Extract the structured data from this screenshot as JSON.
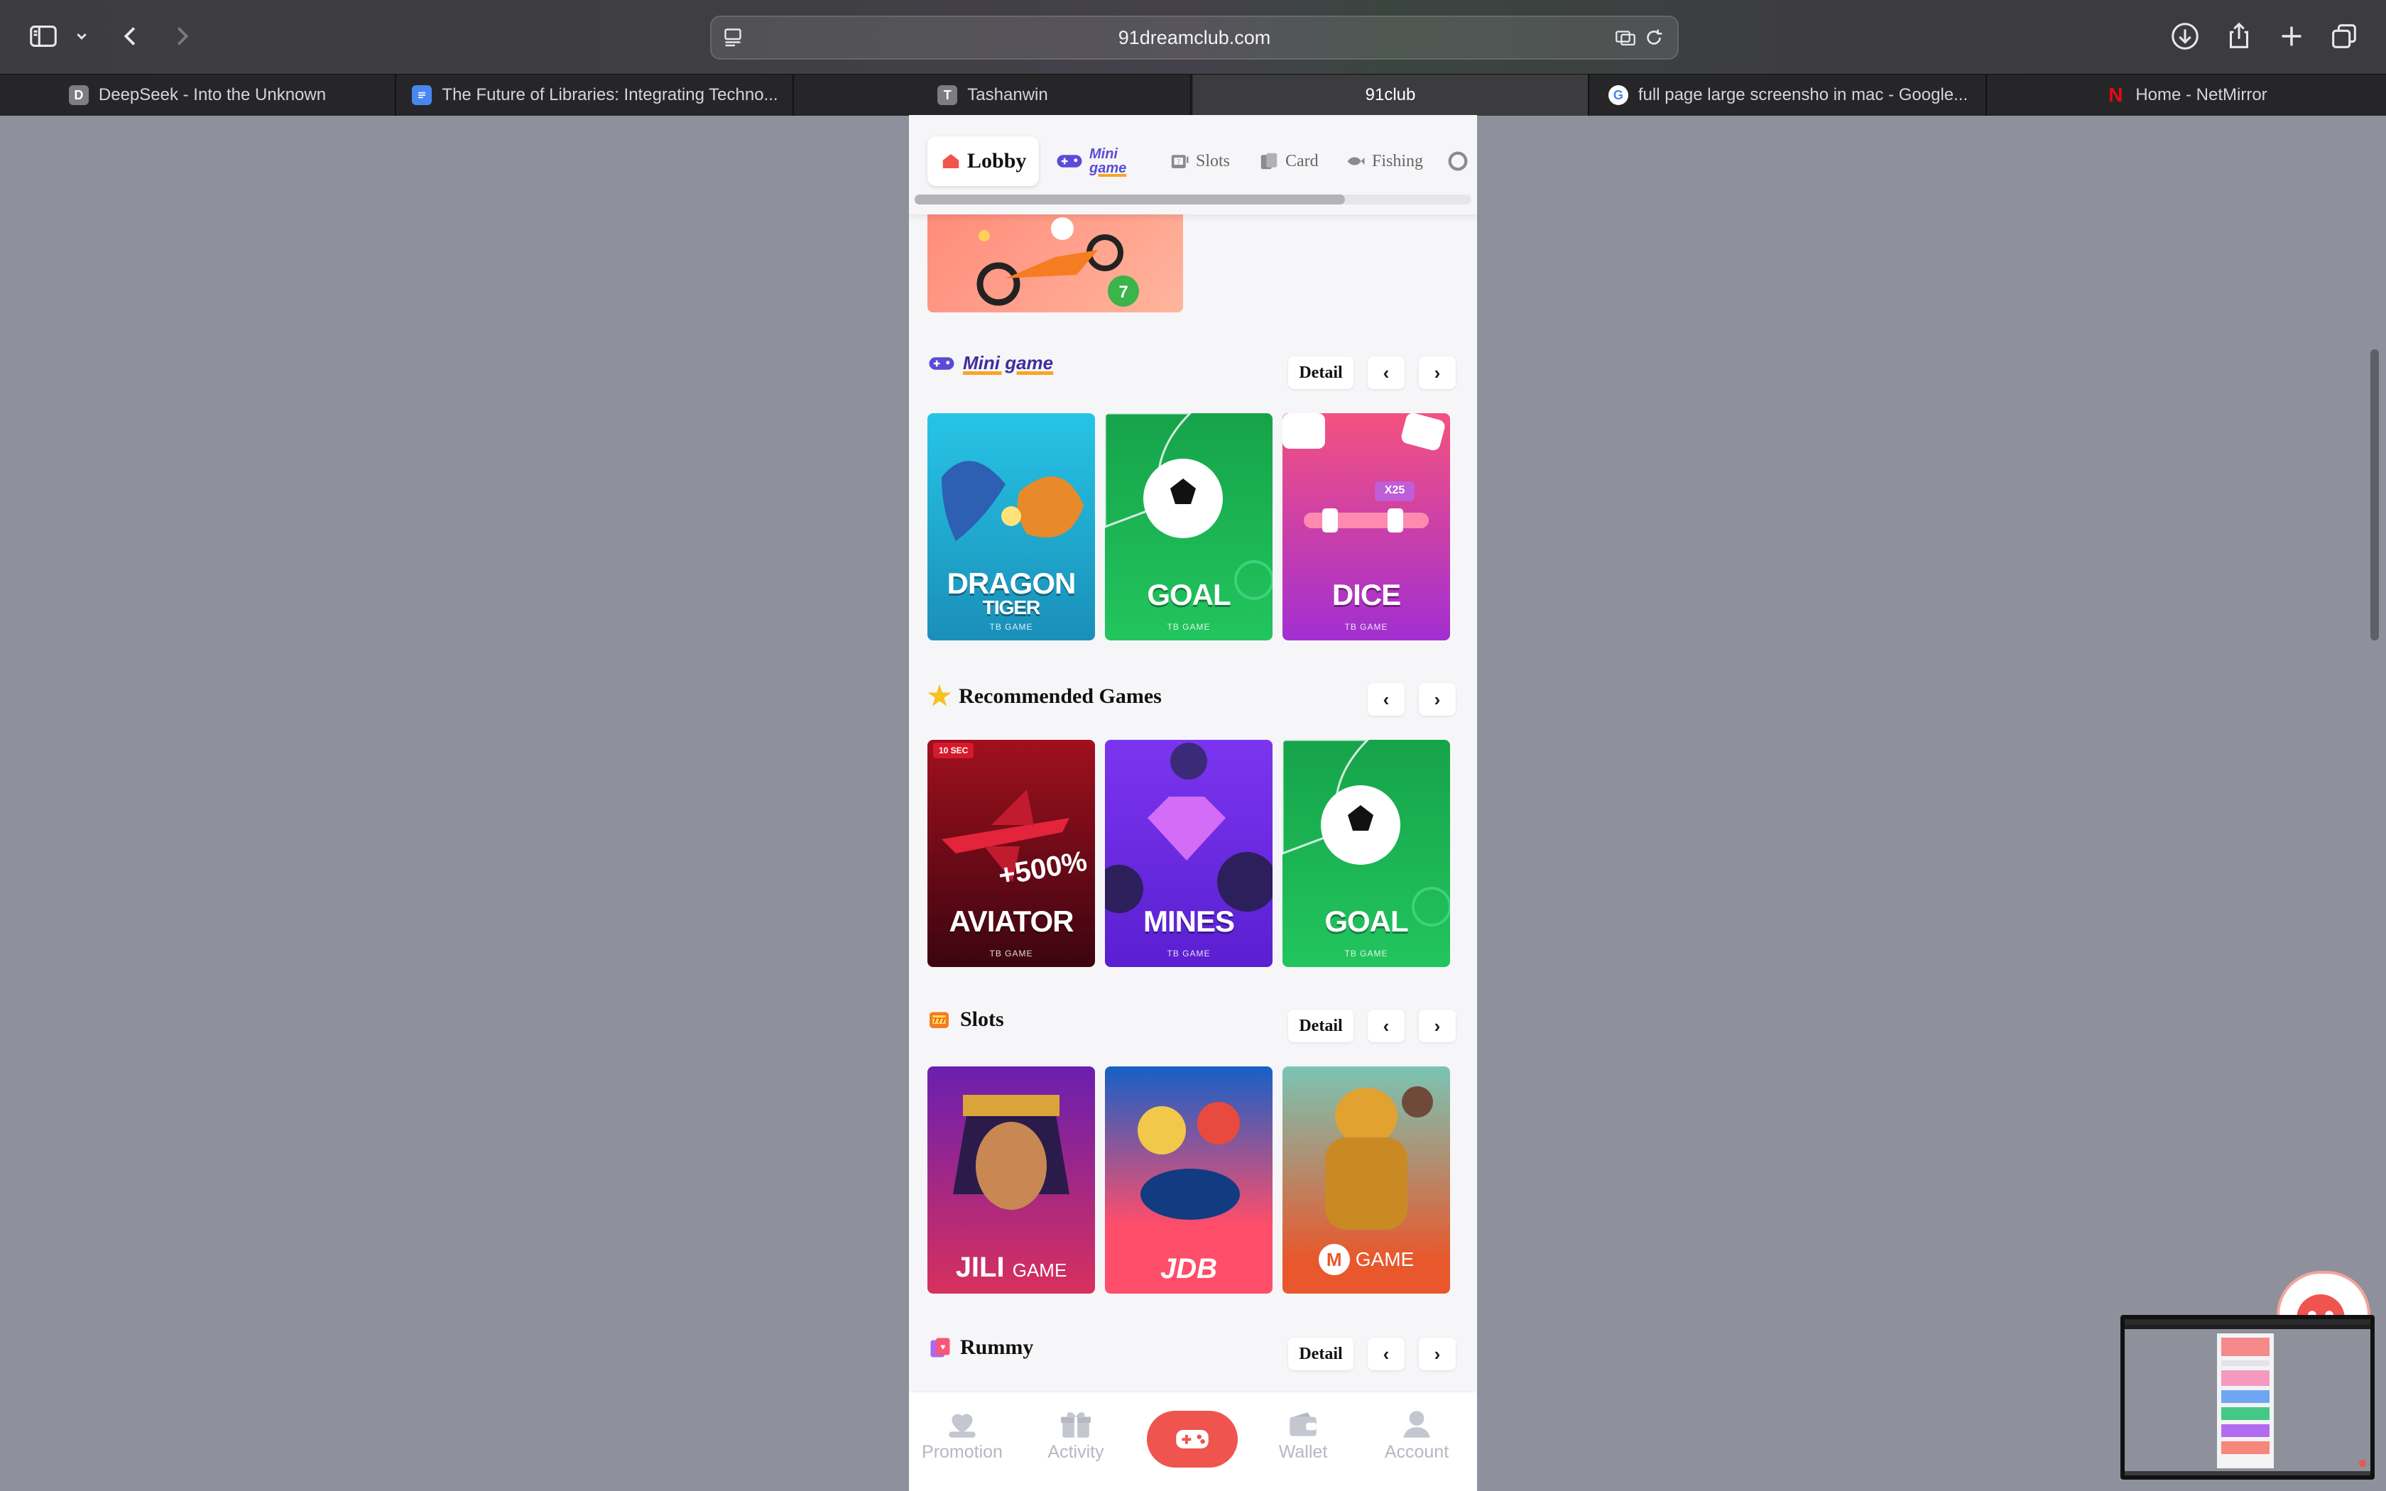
{
  "browser": {
    "url": "91dreamclub.com",
    "tabs": [
      {
        "label": "DeepSeek - Into the Unknown",
        "favicon": "D"
      },
      {
        "label": "The Future of Libraries: Integrating Techno...",
        "favicon": "doc-icon"
      },
      {
        "label": "Tashanwin",
        "favicon": "T"
      },
      {
        "label": "91club",
        "favicon": "",
        "active": true
      },
      {
        "label": "full page large screensho in mac - Google...",
        "favicon": "google-icon"
      },
      {
        "label": "Home - NetMirror",
        "favicon": "netflix-icon"
      }
    ]
  },
  "categories": [
    {
      "label": "Lobby",
      "icon": "home-icon",
      "active": true
    },
    {
      "label": "",
      "icon": "mini-game-logo"
    },
    {
      "label": "Slots",
      "icon": "slots-icon"
    },
    {
      "label": "Card",
      "icon": "card-icon"
    },
    {
      "label": "Fishing",
      "icon": "fish-icon"
    }
  ],
  "sections": {
    "mini_game": {
      "title": "Mini game",
      "detail": "Detail",
      "prev": "‹",
      "next": "›",
      "games": [
        {
          "title": "DRAGON",
          "title2": "TIGER",
          "sub": "TB GAME"
        },
        {
          "title": "GOAL",
          "sub": "TB GAME"
        },
        {
          "title": "DICE",
          "sub": "TB GAME",
          "badge": "X25"
        }
      ]
    },
    "recommended": {
      "title": "Recommended Games",
      "prev": "‹",
      "next": "›",
      "games": [
        {
          "title": "AVIATOR",
          "sub": "TB GAME",
          "badge": "10 SEC",
          "promo": "+500%"
        },
        {
          "title": "MINES",
          "sub": "TB GAME"
        },
        {
          "title": "GOAL",
          "sub": "TB GAME"
        }
      ]
    },
    "slots": {
      "title": "Slots",
      "detail": "Detail",
      "prev": "‹",
      "next": "›",
      "providers": [
        {
          "title": "JILI",
          "title2": "GAME"
        },
        {
          "title": "JDB"
        },
        {
          "title": "GAME"
        }
      ]
    },
    "rummy": {
      "title": "Rummy",
      "detail": "Detail",
      "prev": "‹",
      "next": "›"
    }
  },
  "bottom_nav": [
    {
      "label": "Promotion",
      "icon": "heart-hand-icon"
    },
    {
      "label": "Activity",
      "icon": "gift-icon"
    },
    {
      "label": "",
      "icon": "gamepad-icon",
      "center": true
    },
    {
      "label": "Wallet",
      "icon": "wallet-icon"
    },
    {
      "label": "Account",
      "icon": "account-icon"
    }
  ],
  "colors": {
    "accent": "#f0544f",
    "page_bg": "#f6f6f8",
    "desktop_bg": "#8e919c"
  }
}
